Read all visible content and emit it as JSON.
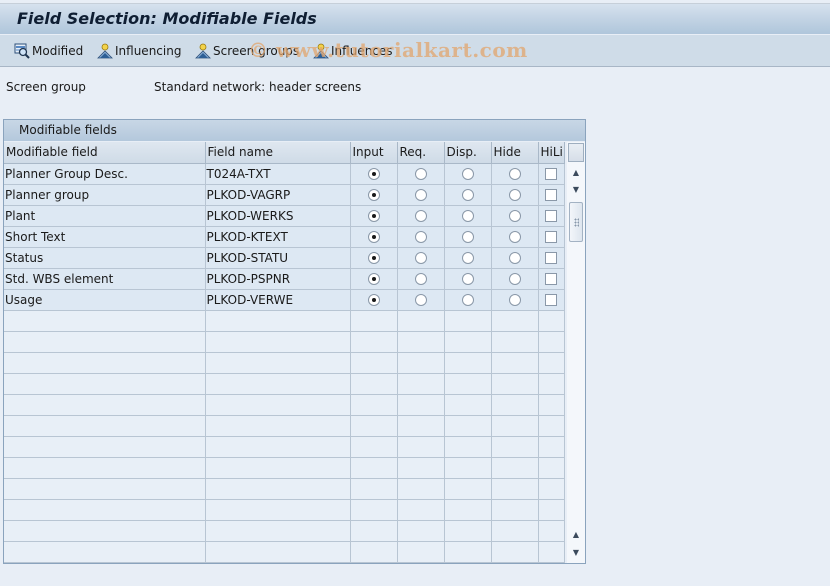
{
  "window": {
    "title": "Field Selection: Modifiable Fields"
  },
  "toolbar": {
    "buttons": [
      {
        "label": "Modified",
        "icon": "magnifier-table-icon"
      },
      {
        "label": "Influencing",
        "icon": "person-icon"
      },
      {
        "label": "Screen groups",
        "icon": "person-icon"
      },
      {
        "label": "Influences",
        "icon": "person-icon"
      }
    ],
    "watermark": "© www.tutorialkart.com"
  },
  "info": {
    "label": "Screen group",
    "value": "Standard network: header screens"
  },
  "panel": {
    "title": "Modifiable fields",
    "columns": [
      "Modifiable field",
      "Field name",
      "Input",
      "Req.",
      "Disp.",
      "Hide",
      "HiLi"
    ],
    "rows": [
      {
        "field": "Planner Group Desc.",
        "name": "T024A-TXT",
        "selected": "Input",
        "hili": false
      },
      {
        "field": "Planner group",
        "name": "PLKOD-VAGRP",
        "selected": "Input",
        "hili": false
      },
      {
        "field": "Plant",
        "name": "PLKOD-WERKS",
        "selected": "Input",
        "hili": false
      },
      {
        "field": "Short Text",
        "name": "PLKOD-KTEXT",
        "selected": "Input",
        "hili": false
      },
      {
        "field": "Status",
        "name": "PLKOD-STATU",
        "selected": "Input",
        "hili": false
      },
      {
        "field": "Std. WBS element",
        "name": "PLKOD-PSPNR",
        "selected": "Input",
        "hili": false
      },
      {
        "field": "Usage",
        "name": "PLKOD-VERWE",
        "selected": "Input",
        "hili": false
      }
    ],
    "empty_rows": 12
  }
}
